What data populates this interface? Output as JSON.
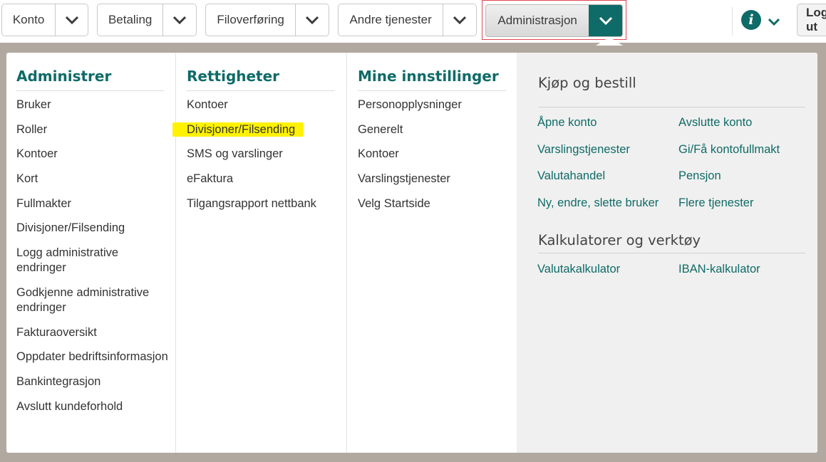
{
  "nav": {
    "items": [
      {
        "label": "Konto"
      },
      {
        "label": "Betaling"
      },
      {
        "label": "Filoverføring"
      },
      {
        "label": "Andre tjenester"
      },
      {
        "label": "Administrasjon"
      }
    ],
    "logout_label": "Logg ut",
    "info_icon": "i",
    "accent": "#0f6b67",
    "highlight": "#fff200",
    "active_frame": "#e0464f"
  },
  "menu": {
    "administrer": {
      "heading": "Administrer",
      "items": [
        "Bruker",
        "Roller",
        "Kontoer",
        "Kort",
        "Fullmakter",
        "Divisjoner/Filsending",
        "Logg administrative endringer",
        "Godkjenne administrative endringer",
        "Fakturaoversikt",
        "Oppdater bedriftsinformasjon",
        "Bankintegrasjon",
        "Avslutt kundeforhold"
      ]
    },
    "rettigheter": {
      "heading": "Rettigheter",
      "items": [
        "Kontoer",
        "Divisjoner/Filsending",
        "SMS og varslinger",
        "eFaktura",
        "Tilgangsrapport nettbank"
      ]
    },
    "mine_innstillinger": {
      "heading": "Mine innstillinger",
      "items": [
        "Personopplysninger",
        "Generelt",
        "Kontoer",
        "Varslingstjenester",
        "Velg Startside"
      ]
    },
    "kjop": {
      "heading": "Kjøp og bestill",
      "links": [
        "Åpne konto",
        "Avslutte konto",
        "Varslingstjenester",
        "Gi/Få kontofullmakt",
        "Valutahandel",
        "Pensjon",
        "Ny, endre, slette bruker",
        "Flere tjenester"
      ]
    },
    "kalkulatorer": {
      "heading": "Kalkulatorer og verktøy",
      "links": [
        "Valutakalkulator",
        "IBAN-kalkulator"
      ]
    }
  }
}
